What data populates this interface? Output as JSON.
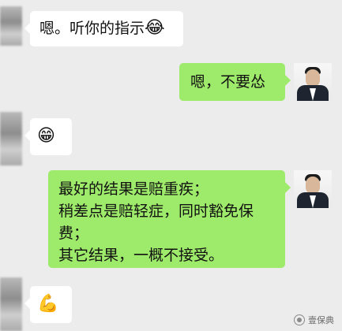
{
  "messages": [
    {
      "side": "left",
      "text": "嗯。听你的指示",
      "emoji": "😂"
    },
    {
      "side": "right",
      "text": "嗯，不要怂"
    },
    {
      "side": "left",
      "emoji": "😁"
    },
    {
      "side": "right",
      "lines": [
        "最好的结果是赔重疾；",
        "稍差点是赔轻症，同时豁免保",
        "费；",
        "其它结果，一概不接受。"
      ]
    },
    {
      "side": "left",
      "emoji": "💪"
    }
  ],
  "watermark": "壹保典"
}
